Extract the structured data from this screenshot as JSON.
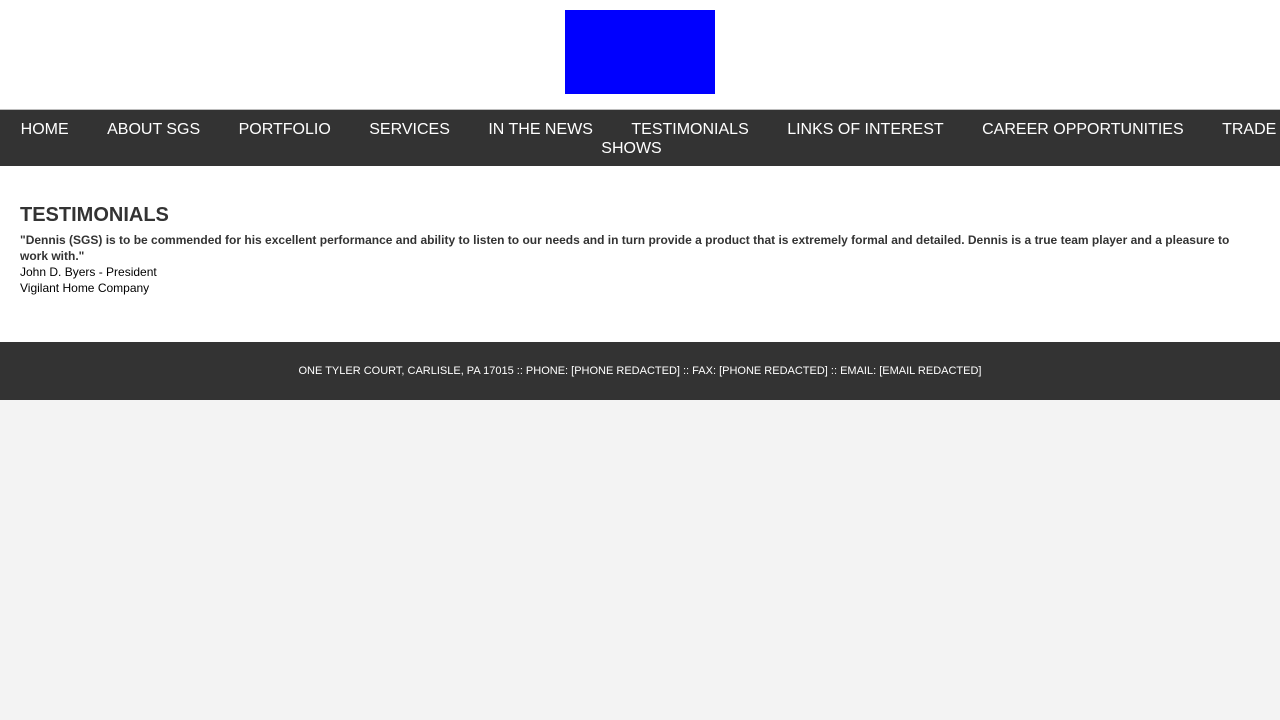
{
  "colors": {
    "logo": "#0000ff",
    "nav_bg": "#333333",
    "footer_bg": "#333333",
    "page_bg": "#f3f3f3"
  },
  "nav": {
    "items": [
      {
        "label": "HOME"
      },
      {
        "label": "ABOUT SGS"
      },
      {
        "label": "PORTFOLIO"
      },
      {
        "label": "SERVICES"
      },
      {
        "label": "IN THE NEWS"
      },
      {
        "label": "TESTIMONIALS"
      },
      {
        "label": "LINKS OF INTEREST"
      },
      {
        "label": "CAREER OPPORTUNITIES"
      },
      {
        "label": "TRADE SHOWS"
      }
    ]
  },
  "main": {
    "title": "TESTIMONIALS",
    "testimonial": {
      "quote": "\"Dennis (SGS) is to be commended for his excellent performance and ability to listen to our needs and in turn provide a product that is extremely formal and detailed. Dennis is a true team player and a pleasure to work with.\"",
      "author": "John D. Byers - President",
      "company": "Vigilant Home Company"
    }
  },
  "footer": {
    "text": "ONE TYLER COURT, CARLISLE, PA 17015 :: PHONE: [PHONE REDACTED] :: FAX: [PHONE REDACTED] :: EMAIL: [EMAIL REDACTED]"
  }
}
